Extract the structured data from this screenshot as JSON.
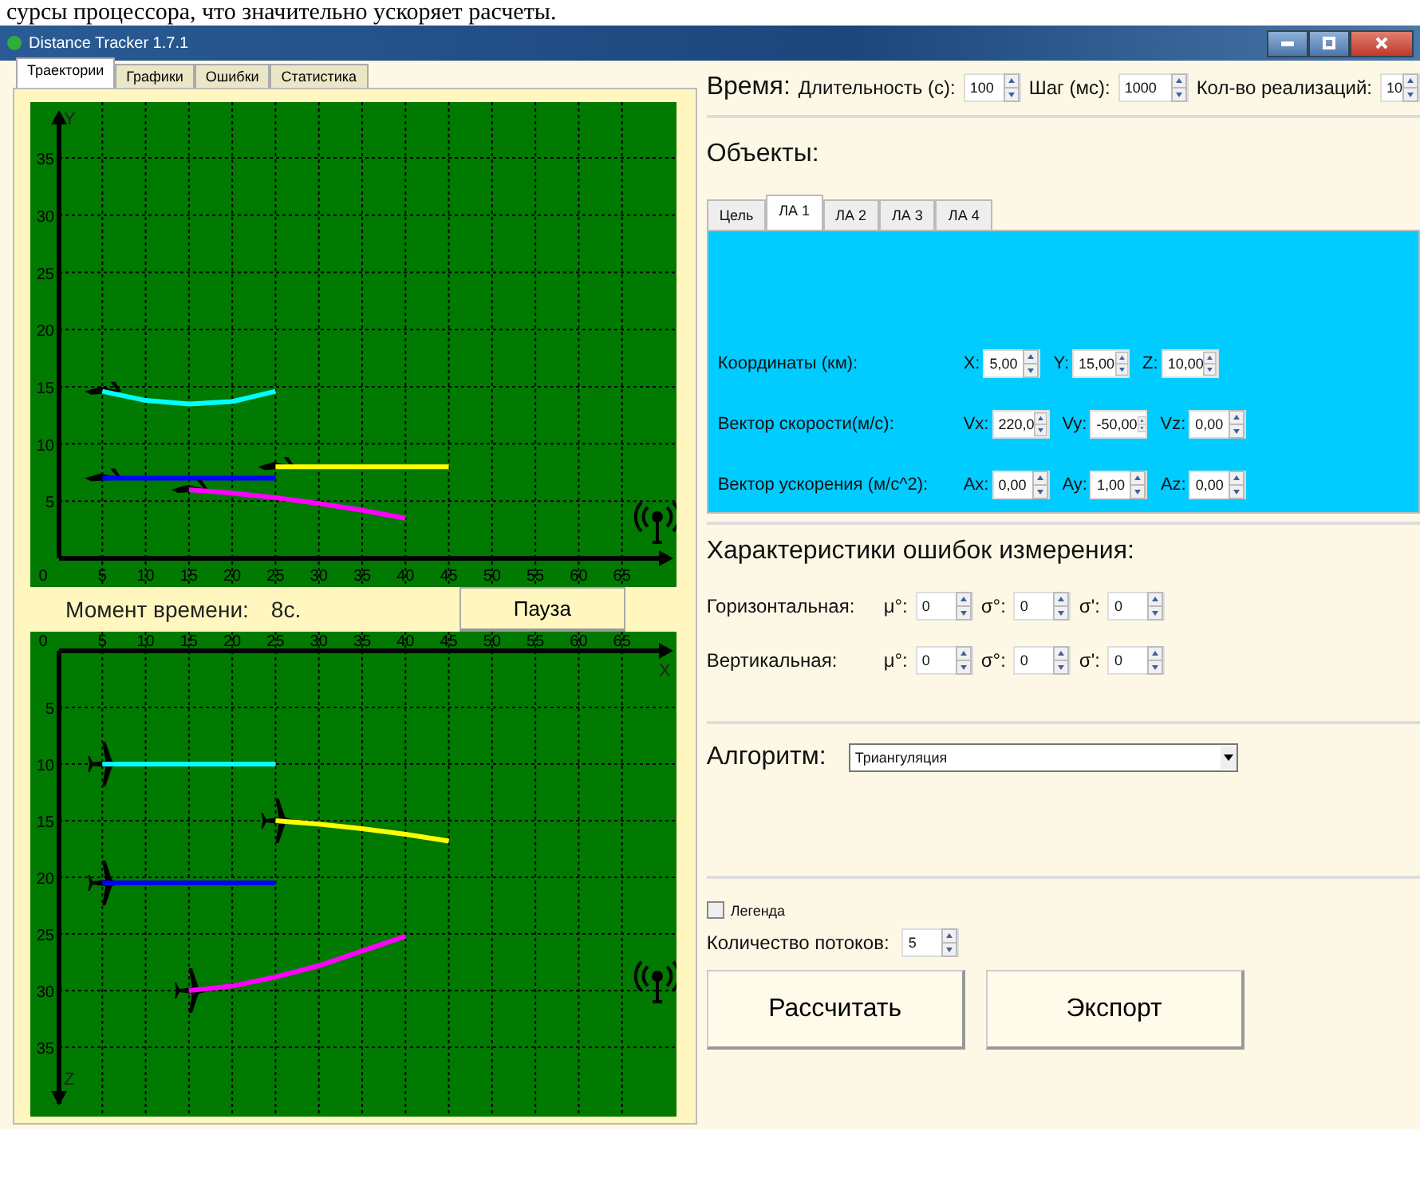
{
  "document_text": "сурсы процессора, что значительно ускоряет расчеты.",
  "window": {
    "title": "Distance Tracker 1.7.1"
  },
  "tabs": [
    {
      "label": "Траектории",
      "selected": true
    },
    {
      "label": "Графики",
      "selected": false
    },
    {
      "label": "Ошибки",
      "selected": false
    },
    {
      "label": "Статистика",
      "selected": false
    }
  ],
  "trajectories": {
    "charts": [
      {
        "origin_label": "0",
        "chart_data": {
          "type": "line",
          "grid": true,
          "ylabel": "Y",
          "x": [
            5,
            10,
            15,
            20,
            25,
            30,
            35,
            40,
            45
          ],
          "xlim": [
            0,
            70
          ],
          "ylim": [
            0,
            40
          ],
          "xticks": [
            5,
            10,
            15,
            20,
            25,
            30,
            35,
            40,
            45,
            50,
            55,
            60,
            65
          ],
          "yticks": [
            5,
            10,
            15,
            20,
            25,
            30,
            35
          ],
          "series": [
            {
              "color": "#00ffff",
              "values": [
                14.6,
                13.8,
                13.5,
                13.7,
                14.6,
                null,
                null,
                null,
                null
              ]
            },
            {
              "color": "#0000ff",
              "values": [
                7,
                7,
                7,
                7,
                7,
                null,
                null,
                null,
                null
              ]
            },
            {
              "color": "#ffff00",
              "values": [
                null,
                null,
                null,
                null,
                8,
                8,
                8,
                8,
                8
              ]
            },
            {
              "color": "#ff00ff",
              "values": [
                null,
                null,
                6,
                5.7,
                5.3,
                4.8,
                4.2,
                3.5,
                null
              ]
            }
          ]
        }
      },
      {
        "origin_label": "0",
        "chart_data": {
          "type": "line",
          "grid": true,
          "xlabel": "X",
          "ylabel": "Z",
          "x": [
            5,
            10,
            15,
            20,
            25,
            30,
            35,
            40,
            45
          ],
          "xlim": [
            0,
            70
          ],
          "ylim": [
            40,
            0
          ],
          "xticks": [
            5,
            10,
            15,
            20,
            25,
            30,
            35,
            40,
            45,
            50,
            55,
            60,
            65
          ],
          "yticks": [
            5,
            10,
            15,
            20,
            25,
            30,
            35
          ],
          "series": [
            {
              "color": "#00ffff",
              "values": [
                10,
                10,
                10,
                10,
                10,
                null,
                null,
                null,
                null
              ]
            },
            {
              "color": "#ffff00",
              "values": [
                null,
                null,
                null,
                null,
                15,
                15.3,
                15.7,
                16.2,
                16.8
              ]
            },
            {
              "color": "#0000ff",
              "values": [
                20.5,
                20.5,
                20.5,
                20.5,
                20.5,
                null,
                null,
                null,
                null
              ]
            },
            {
              "color": "#ff00ff",
              "values": [
                null,
                null,
                30,
                29.6,
                28.8,
                27.8,
                26.5,
                25.2,
                null
              ]
            }
          ]
        }
      }
    ],
    "time_label": "Момент времени:",
    "time_value": "8с.",
    "pause_button": "Пауза"
  },
  "time": {
    "heading": "Время:",
    "fields": [
      {
        "label": "Длительность (с):",
        "value": "100"
      },
      {
        "label": "Шаг (мс):",
        "value": "1000"
      },
      {
        "label": "Кол-во реализаций:",
        "value": "10"
      }
    ]
  },
  "objects": {
    "heading": "Объекты:",
    "tabs": [
      {
        "label": "Цель",
        "selected": false
      },
      {
        "label": "ЛА 1",
        "selected": true
      },
      {
        "label": "ЛА 2",
        "selected": false
      },
      {
        "label": "ЛА 3",
        "selected": false
      },
      {
        "label": "ЛА 4",
        "selected": false
      }
    ],
    "rows": [
      {
        "label": "Координаты (км):",
        "fields": [
          {
            "label": "X:",
            "value": "5,00"
          },
          {
            "label": "Y:",
            "value": "15,00"
          },
          {
            "label": "Z:",
            "value": "10,00"
          }
        ]
      },
      {
        "label": "Вектор скорости(м/с):",
        "fields": [
          {
            "label": "Vx:",
            "value": "220,0"
          },
          {
            "label": "Vy:",
            "value": "-50,00"
          },
          {
            "label": "Vz:",
            "value": "0,00"
          }
        ]
      },
      {
        "label": "Вектор ускорения (м/с^2):",
        "fields": [
          {
            "label": "Ax:",
            "value": "0,00"
          },
          {
            "label": "Ay:",
            "value": "1,00"
          },
          {
            "label": "Az:",
            "value": "0,00"
          }
        ]
      }
    ]
  },
  "errors": {
    "heading": "Характеристики ошибок измерения:",
    "rows": [
      {
        "label": "Горизонтальная:",
        "fields": [
          {
            "label": "μ°:",
            "value": "0"
          },
          {
            "label": "σ°:",
            "value": "0"
          },
          {
            "label": "σ':",
            "value": "0"
          }
        ]
      },
      {
        "label": "Вертикальная:",
        "fields": [
          {
            "label": "μ°:",
            "value": "0"
          },
          {
            "label": "σ°:",
            "value": "0"
          },
          {
            "label": "σ':",
            "value": "0"
          }
        ]
      }
    ]
  },
  "algorithm": {
    "label": "Алгоритм:",
    "value": "Триангуляция"
  },
  "legend": {
    "label": "Легенда",
    "checked": false
  },
  "threads": {
    "label": "Количество потоков:",
    "value": "5"
  },
  "buttons": [
    "Рассчитать",
    "Экспорт"
  ]
}
